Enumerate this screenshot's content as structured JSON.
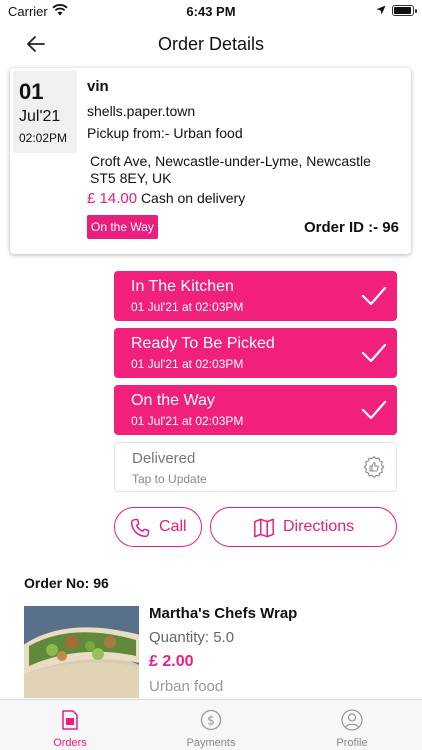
{
  "status_bar": {
    "carrier": "Carrier",
    "time": "6:43 PM",
    "battery_level": 0.95
  },
  "nav": {
    "title": "Order Details"
  },
  "order": {
    "day": "01",
    "month": "Jul'21",
    "time": "02:02PM",
    "customer": "vin",
    "location": "shells.paper.town",
    "pickup": "Pickup from:- Urban food",
    "address": " Croft Ave, Newcastle-under-Lyme, Newcastle ST5 8EY, UK",
    "price": "£ 14.00",
    "payment": "Cash on delivery",
    "status": "On the Way",
    "order_id": "Order ID :- 96"
  },
  "steps": [
    {
      "title": "In The Kitchen",
      "time": "01 Jul'21 at 02:03PM",
      "done": true
    },
    {
      "title": "Ready To Be Picked",
      "time": "01 Jul'21 at 02:03PM",
      "done": true
    },
    {
      "title": "On the Way",
      "time": "01 Jul'21 at 02:03PM",
      "done": true
    },
    {
      "title": "Delivered",
      "time": "Tap to Update",
      "done": false
    }
  ],
  "actions": {
    "call": "Call",
    "directions": "Directions"
  },
  "items_section": {
    "order_no": "Order No: 96",
    "items": [
      {
        "name": "Martha's Chefs Wrap",
        "quantity": "Quantity: 5.0",
        "price": "£ 2.00",
        "store": "Urban food"
      }
    ]
  },
  "tabs": [
    {
      "label": "Orders",
      "icon": "orders-icon",
      "active": true
    },
    {
      "label": "Payments",
      "icon": "payments-icon",
      "active": false
    },
    {
      "label": "Profile",
      "icon": "profile-icon",
      "active": false
    }
  ],
  "colors": {
    "accent": "#e91e7d",
    "step_done": "#f2207d"
  }
}
